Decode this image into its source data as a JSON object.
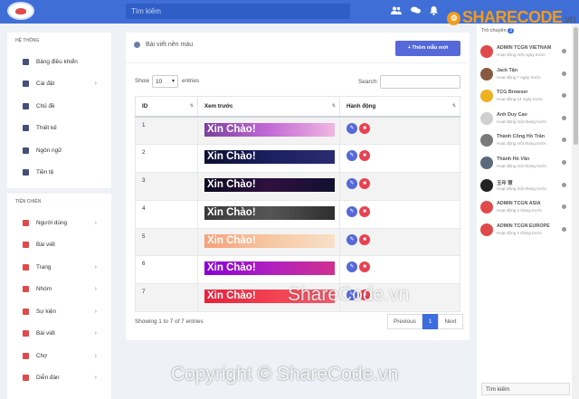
{
  "topbar": {
    "search_placeholder": "Tìm kiếm",
    "icons": [
      "users-icon",
      "chat-icon",
      "bell-icon",
      "avatar"
    ]
  },
  "brand": {
    "name": "SHARECODE",
    "suffix": ".vn",
    "color": "#f29b1a"
  },
  "sidebar": {
    "section1_title": "HỆ THỐNG",
    "section1_items": [
      {
        "label": "Bảng điều khiển",
        "icon": "dashboard-icon",
        "chevron": false
      },
      {
        "label": "Cài đặt",
        "icon": "gear-icon",
        "chevron": true
      },
      {
        "label": "Chủ đề",
        "icon": "monitor-icon",
        "chevron": false
      },
      {
        "label": "Thiết kế",
        "icon": "brush-icon",
        "chevron": false
      },
      {
        "label": "Ngôn ngữ",
        "icon": "language-icon",
        "chevron": false
      },
      {
        "label": "Tiền tệ",
        "icon": "currency-icon",
        "chevron": false
      }
    ],
    "section2_title": "TIỆN CHIẾN",
    "section2_items": [
      {
        "label": "Người dùng",
        "icon": "user-icon",
        "chevron": true
      },
      {
        "label": "Bài viết",
        "icon": "post-icon",
        "chevron": false
      },
      {
        "label": "Trang",
        "icon": "flag-icon",
        "chevron": true
      },
      {
        "label": "Nhóm",
        "icon": "group-icon",
        "chevron": true
      },
      {
        "label": "Sự kiện",
        "icon": "calendar-icon",
        "chevron": true
      },
      {
        "label": "Bài viết",
        "icon": "blog-icon",
        "chevron": true
      },
      {
        "label": "Chợ",
        "icon": "cart-icon",
        "chevron": true
      },
      {
        "label": "Diễn đàn",
        "icon": "forum-icon",
        "chevron": true
      }
    ]
  },
  "main": {
    "title": "Bài viết nền màu",
    "add_button": "Thêm mẫu mới",
    "show_label": "Show",
    "page_size": "10",
    "entries_label": "entries",
    "search_label": "Search:",
    "columns": [
      "ID",
      "Xem trước",
      "Hành động"
    ],
    "rows": [
      {
        "id": "1",
        "preview": "Xin Chào!",
        "bg": "linear-gradient(90deg,#7b3fa0,#c36ad6,#f0b6e0)"
      },
      {
        "id": "2",
        "preview": "Xin Chào!",
        "bg": "linear-gradient(90deg,#0d1030,#1a2060,#2a2a70)"
      },
      {
        "id": "3",
        "preview": "Xin Chào!",
        "bg": "linear-gradient(90deg,#0a0a20,#301040,#101030)"
      },
      {
        "id": "4",
        "preview": "Xin Chào!",
        "bg": "linear-gradient(90deg,#3a3a3a,#555,#2f2f2f)"
      },
      {
        "id": "5",
        "preview": "Xin Chào!",
        "bg": "linear-gradient(90deg,#f7a07a,#f6c7a2,#f9e0c8)"
      },
      {
        "id": "6",
        "preview": "Xin Chào!",
        "bg": "linear-gradient(90deg,#8a00d4,#b020c0,#d03090)"
      },
      {
        "id": "7",
        "preview": "Xin Chào!",
        "bg": "linear-gradient(90deg,#e8203a,#f24050,#f06070)"
      }
    ],
    "showing_text": "Showing 1 to 7 of 7 entries",
    "pager": {
      "prev": "Previous",
      "current": "1",
      "next": "Next"
    }
  },
  "chat": {
    "title": "Trò chuyện",
    "count": "3",
    "items": [
      {
        "name": "ADMIN TCGN VIETNAM",
        "status": "Hoạt động một ngày trước",
        "avatar": "#e04a4a"
      },
      {
        "name": "Jack Tận",
        "status": "Hoạt động 7 ngày trước",
        "avatar": "#8a5a40"
      },
      {
        "name": "TCG Browser",
        "status": "Hoạt động 14 ngày trước",
        "avatar": "#f0b020"
      },
      {
        "name": "Anh Duy Cao",
        "status": "Hoạt động một tháng trước",
        "avatar": "#cfcfcf"
      },
      {
        "name": "Thành Công Hồ Trần",
        "status": "Hoạt động một tháng trước",
        "avatar": "#7a7a7a"
      },
      {
        "name": "Thành Hồ Văn",
        "status": "Hoạt động một tháng trước",
        "avatar": "#5a6a7a"
      },
      {
        "name": "玉年 慧",
        "status": "Hoạt động một tháng trước",
        "avatar": "#222222"
      },
      {
        "name": "ADMIN TCGN ASIA",
        "status": "Hoạt động 2 tháng trước",
        "avatar": "#e04a4a"
      },
      {
        "name": "ADMIN TCGN EUROPE",
        "status": "Hoạt động 2 tháng trước",
        "avatar": "#e04a4a"
      }
    ],
    "search_placeholder": "Tìm kiếm"
  },
  "watermarks": [
    "ShareCode.vn",
    "Copyright © ShareCode.vn"
  ]
}
